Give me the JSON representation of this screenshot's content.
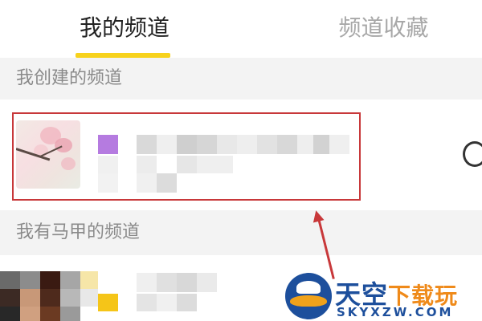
{
  "tabs": [
    {
      "label": "我的频道",
      "active": true
    },
    {
      "label": "频道收藏",
      "active": false
    }
  ],
  "sections": {
    "created": {
      "title": "我创建的频道"
    },
    "alt": {
      "title": "我有马甲的频道"
    }
  },
  "colors": {
    "accent_underline": "#f7d21c",
    "highlight_border": "#c8383a",
    "section_bg": "#f3f3f3"
  },
  "icons": {
    "chat": "chat-bubble-icon"
  },
  "watermark": {
    "title_blue": "天空",
    "title_orange": "下载玩",
    "subtitle": "SKYXZW.COM"
  }
}
